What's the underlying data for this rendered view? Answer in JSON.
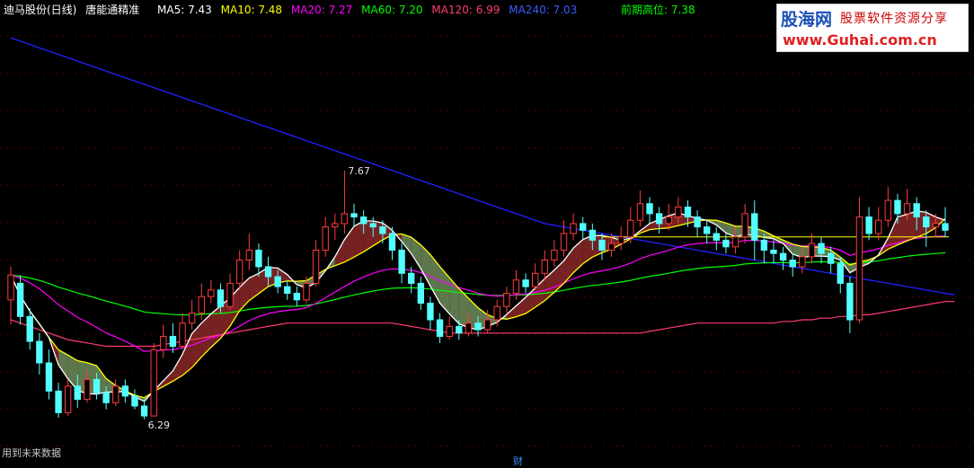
{
  "header": {
    "stock_name": "迪马股份(日线)",
    "indicator_name": "唐能通精准",
    "ma5": "MA5: 7.43",
    "ma10": "MA10: 7.48",
    "ma20": "MA20: 7.27",
    "ma60": "MA60: 7.20",
    "ma120": "MA120: 6.99",
    "ma240": "MA240: 7.03",
    "prev_high": "前期高位: 7.38"
  },
  "logo": {
    "site": "股海网",
    "tagline": "股票软件资源分享",
    "url": "www.Guhai.com.cn"
  },
  "footer": {
    "note": "用到未来数据",
    "bottom_marker": "财"
  },
  "colors": {
    "ma5": "#ffffff",
    "ma10": "#ffff00",
    "ma20": "#ff00ff",
    "ma60": "#00ff00",
    "ma120": "#ff3c6e",
    "ma240": "#2020ff",
    "prev_high": "#ffff00",
    "up_candle": "#ff3c3c",
    "down_candle": "#54ffff"
  },
  "chart_data": {
    "type": "candlestick",
    "price_labels": [
      {
        "text": "7.67",
        "kind": "high"
      },
      {
        "text": "6.29",
        "kind": "low"
      }
    ],
    "ylim": [
      6.1,
      8.7
    ],
    "candles": [
      [
        7.0,
        7.15,
        6.85,
        7.2
      ],
      [
        7.1,
        6.9,
        6.85,
        7.15
      ],
      [
        6.9,
        6.75,
        6.7,
        6.95
      ],
      [
        6.75,
        6.62,
        6.55,
        6.8
      ],
      [
        6.62,
        6.45,
        6.4,
        6.7
      ],
      [
        6.45,
        6.32,
        6.29,
        6.5
      ],
      [
        6.32,
        6.48,
        6.3,
        6.52
      ],
      [
        6.48,
        6.4,
        6.35,
        6.55
      ],
      [
        6.4,
        6.52,
        6.38,
        6.58
      ],
      [
        6.52,
        6.44,
        6.4,
        6.56
      ],
      [
        6.44,
        6.38,
        6.34,
        6.48
      ],
      [
        6.38,
        6.48,
        6.36,
        6.52
      ],
      [
        6.48,
        6.42,
        6.38,
        6.52
      ],
      [
        6.42,
        6.36,
        6.34,
        6.46
      ],
      [
        6.36,
        6.3,
        6.28,
        6.4
      ],
      [
        6.3,
        6.7,
        6.3,
        6.74
      ],
      [
        6.7,
        6.78,
        6.65,
        6.85
      ],
      [
        6.78,
        6.72,
        6.68,
        6.86
      ],
      [
        6.72,
        6.86,
        6.7,
        6.92
      ],
      [
        6.86,
        6.92,
        6.82,
        7.0
      ],
      [
        6.92,
        7.02,
        6.88,
        7.1
      ],
      [
        7.02,
        7.06,
        6.98,
        7.12
      ],
      [
        7.06,
        6.96,
        6.92,
        7.1
      ],
      [
        6.96,
        7.1,
        6.94,
        7.16
      ],
      [
        7.1,
        7.24,
        7.06,
        7.3
      ],
      [
        7.24,
        7.3,
        7.18,
        7.4
      ],
      [
        7.3,
        7.2,
        7.14,
        7.34
      ],
      [
        7.2,
        7.14,
        7.08,
        7.26
      ],
      [
        7.14,
        7.08,
        7.04,
        7.18
      ],
      [
        7.08,
        7.04,
        7.0,
        7.12
      ],
      [
        7.04,
        7.0,
        6.96,
        7.08
      ],
      [
        7.0,
        7.1,
        6.98,
        7.14
      ],
      [
        7.1,
        7.3,
        7.08,
        7.36
      ],
      [
        7.3,
        7.44,
        7.26,
        7.5
      ],
      [
        7.44,
        7.46,
        7.36,
        7.52
      ],
      [
        7.46,
        7.52,
        7.4,
        7.78
      ],
      [
        7.52,
        7.5,
        7.44,
        7.58
      ],
      [
        7.5,
        7.46,
        7.4,
        7.54
      ],
      [
        7.46,
        7.44,
        7.38,
        7.5
      ],
      [
        7.44,
        7.4,
        7.34,
        7.48
      ],
      [
        7.4,
        7.3,
        7.24,
        7.44
      ],
      [
        7.3,
        7.16,
        7.1,
        7.34
      ],
      [
        7.16,
        7.1,
        7.04,
        7.2
      ],
      [
        7.1,
        6.98,
        6.94,
        7.14
      ],
      [
        6.98,
        6.88,
        6.82,
        7.02
      ],
      [
        6.88,
        6.78,
        6.74,
        6.92
      ],
      [
        6.78,
        6.84,
        6.76,
        6.9
      ],
      [
        6.84,
        6.8,
        6.76,
        6.88
      ],
      [
        6.8,
        6.86,
        6.78,
        6.92
      ],
      [
        6.86,
        6.82,
        6.78,
        6.9
      ],
      [
        6.82,
        6.88,
        6.8,
        6.94
      ],
      [
        6.88,
        6.96,
        6.84,
        7.0
      ],
      [
        6.96,
        7.04,
        6.92,
        7.08
      ],
      [
        7.04,
        7.12,
        7.0,
        7.18
      ],
      [
        7.12,
        7.08,
        7.04,
        7.16
      ],
      [
        7.08,
        7.16,
        7.06,
        7.22
      ],
      [
        7.16,
        7.24,
        7.12,
        7.3
      ],
      [
        7.24,
        7.3,
        7.2,
        7.36
      ],
      [
        7.3,
        7.4,
        7.26,
        7.48
      ],
      [
        7.4,
        7.46,
        7.36,
        7.52
      ],
      [
        7.46,
        7.42,
        7.36,
        7.5
      ],
      [
        7.42,
        7.36,
        7.3,
        7.46
      ],
      [
        7.36,
        7.3,
        7.24,
        7.4
      ],
      [
        7.3,
        7.34,
        7.26,
        7.4
      ],
      [
        7.34,
        7.38,
        7.3,
        7.44
      ],
      [
        7.38,
        7.48,
        7.34,
        7.56
      ],
      [
        7.48,
        7.58,
        7.44,
        7.66
      ],
      [
        7.58,
        7.52,
        7.46,
        7.62
      ],
      [
        7.52,
        7.46,
        7.4,
        7.56
      ],
      [
        7.46,
        7.5,
        7.42,
        7.58
      ],
      [
        7.5,
        7.56,
        7.46,
        7.62
      ],
      [
        7.56,
        7.5,
        7.44,
        7.6
      ],
      [
        7.5,
        7.44,
        7.38,
        7.54
      ],
      [
        7.44,
        7.4,
        7.34,
        7.48
      ],
      [
        7.4,
        7.36,
        7.3,
        7.44
      ],
      [
        7.36,
        7.32,
        7.28,
        7.4
      ],
      [
        7.32,
        7.38,
        7.28,
        7.44
      ],
      [
        7.38,
        7.52,
        7.34,
        7.58
      ],
      [
        7.52,
        7.36,
        7.24,
        7.6
      ],
      [
        7.36,
        7.3,
        7.22,
        7.4
      ],
      [
        7.3,
        7.28,
        7.22,
        7.36
      ],
      [
        7.28,
        7.24,
        7.18,
        7.32
      ],
      [
        7.24,
        7.2,
        7.14,
        7.28
      ],
      [
        7.2,
        7.26,
        7.16,
        7.32
      ],
      [
        7.26,
        7.34,
        7.22,
        7.4
      ],
      [
        7.34,
        7.28,
        7.22,
        7.38
      ],
      [
        7.28,
        7.22,
        7.16,
        7.32
      ],
      [
        7.22,
        7.1,
        7.04,
        7.26
      ],
      [
        7.1,
        6.88,
        6.8,
        7.14
      ],
      [
        6.88,
        7.5,
        6.86,
        7.62
      ],
      [
        7.5,
        7.4,
        7.36,
        7.56
      ],
      [
        7.4,
        7.48,
        7.36,
        7.56
      ],
      [
        7.48,
        7.6,
        7.44,
        7.68
      ],
      [
        7.6,
        7.52,
        7.46,
        7.64
      ],
      [
        7.52,
        7.58,
        7.48,
        7.67
      ],
      [
        7.58,
        7.5,
        7.42,
        7.62
      ],
      [
        7.5,
        7.44,
        7.32,
        7.54
      ],
      [
        7.44,
        7.46,
        7.38,
        7.52
      ],
      [
        7.46,
        7.42,
        7.38,
        7.56
      ]
    ],
    "ma240": [
      8.58,
      8.56,
      8.54,
      8.52,
      8.5,
      8.48,
      8.46,
      8.44,
      8.42,
      8.4,
      8.38,
      8.36,
      8.34,
      8.32,
      8.3,
      8.28,
      8.26,
      8.24,
      8.22,
      8.2,
      8.18,
      8.16,
      8.14,
      8.12,
      8.1,
      8.08,
      8.06,
      8.04,
      8.02,
      8.0,
      7.98,
      7.96,
      7.94,
      7.92,
      7.9,
      7.88,
      7.86,
      7.84,
      7.82,
      7.8,
      7.78,
      7.76,
      7.74,
      7.72,
      7.7,
      7.68,
      7.66,
      7.64,
      7.62,
      7.6,
      7.58,
      7.56,
      7.54,
      7.52,
      7.5,
      7.48,
      7.46,
      7.45,
      7.44,
      7.43,
      7.42,
      7.41,
      7.4,
      7.39,
      7.38,
      7.37,
      7.36,
      7.35,
      7.34,
      7.33,
      7.32,
      7.31,
      7.3,
      7.29,
      7.28,
      7.27,
      7.26,
      7.25,
      7.24,
      7.23,
      7.22,
      7.21,
      7.2,
      7.19,
      7.18,
      7.17,
      7.16,
      7.15,
      7.14,
      7.13,
      7.12,
      7.11,
      7.1,
      7.09,
      7.08,
      7.07,
      7.06,
      7.05,
      7.04,
      7.03
    ],
    "ma120": [
      6.88,
      6.86,
      6.84,
      6.82,
      6.8,
      6.78,
      6.76,
      6.75,
      6.74,
      6.73,
      6.72,
      6.72,
      6.72,
      6.72,
      6.72,
      6.72,
      6.73,
      6.74,
      6.75,
      6.76,
      6.77,
      6.78,
      6.79,
      6.8,
      6.81,
      6.82,
      6.83,
      6.84,
      6.85,
      6.86,
      6.86,
      6.86,
      6.86,
      6.86,
      6.86,
      6.86,
      6.86,
      6.86,
      6.86,
      6.86,
      6.86,
      6.85,
      6.84,
      6.83,
      6.82,
      6.81,
      6.8,
      6.8,
      6.8,
      6.8,
      6.8,
      6.8,
      6.8,
      6.8,
      6.8,
      6.8,
      6.8,
      6.8,
      6.8,
      6.8,
      6.8,
      6.8,
      6.8,
      6.8,
      6.8,
      6.8,
      6.8,
      6.81,
      6.82,
      6.83,
      6.84,
      6.85,
      6.86,
      6.86,
      6.86,
      6.86,
      6.86,
      6.86,
      6.86,
      6.86,
      6.86,
      6.87,
      6.87,
      6.88,
      6.88,
      6.89,
      6.89,
      6.9,
      6.9,
      6.91,
      6.91,
      6.92,
      6.93,
      6.94,
      6.95,
      6.96,
      6.97,
      6.98,
      6.99,
      6.99
    ]
  }
}
